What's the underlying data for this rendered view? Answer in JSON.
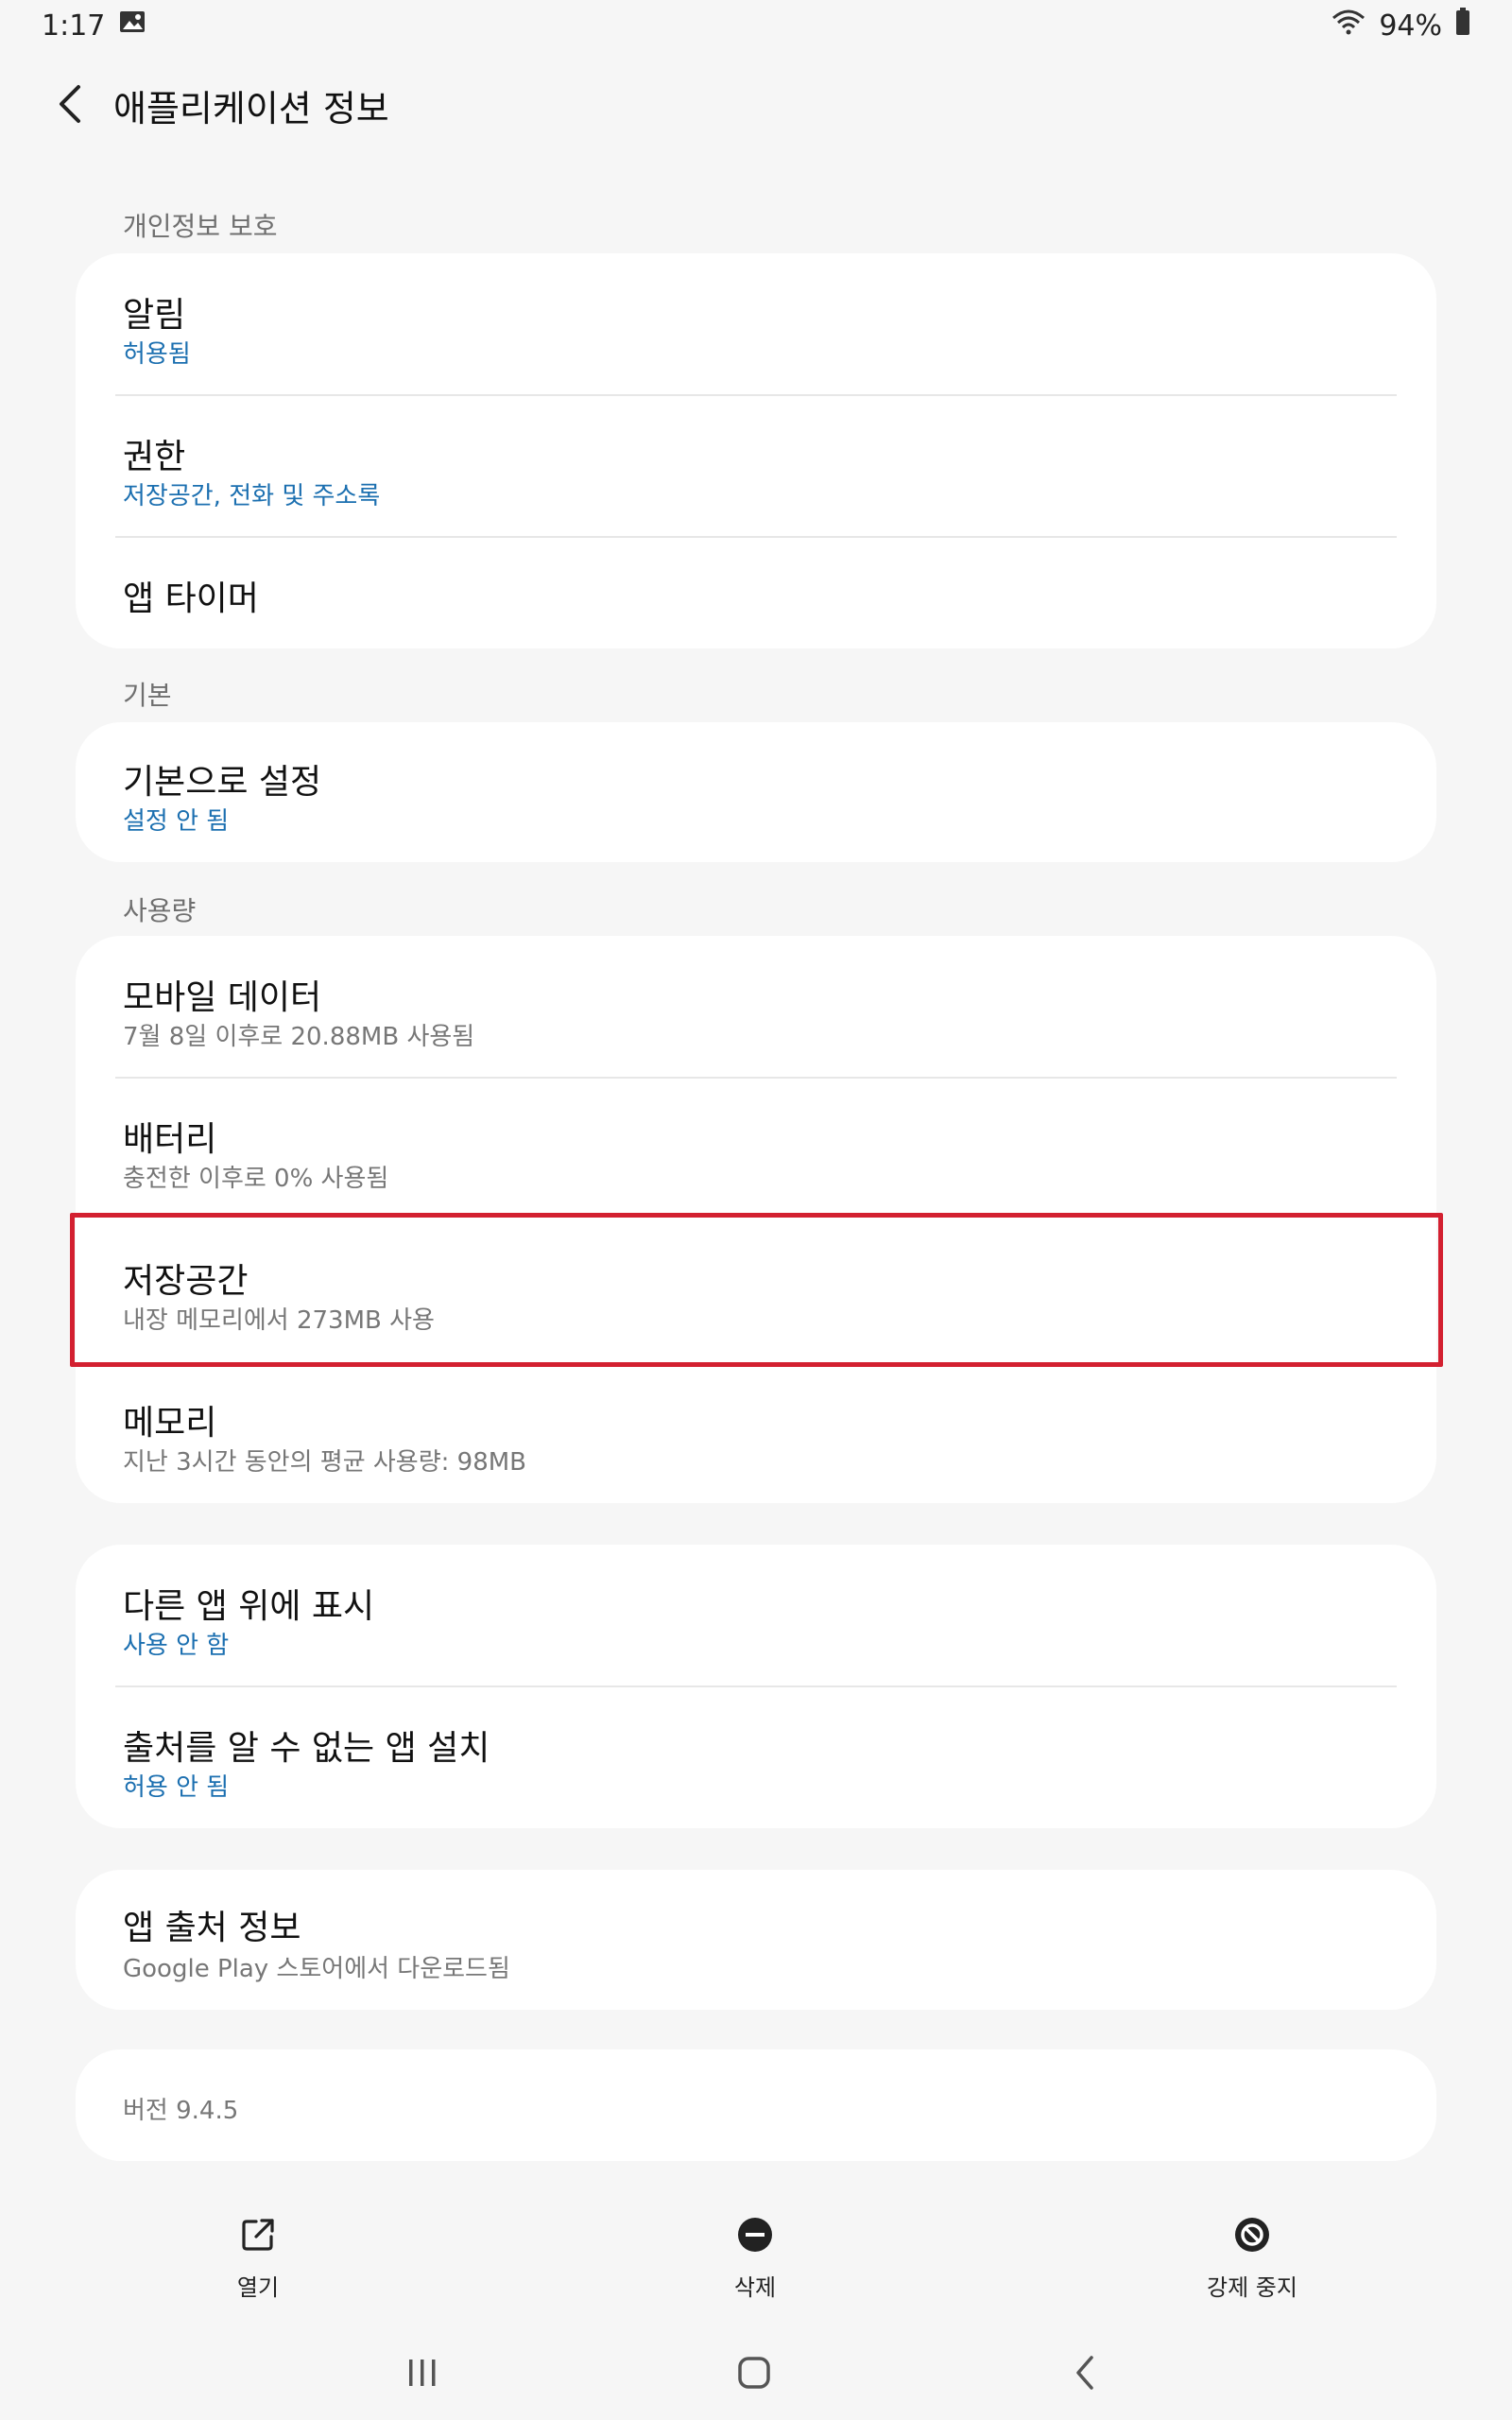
{
  "status": {
    "time": "1:17",
    "battery": "94%"
  },
  "header": {
    "title": "애플리케이션 정보"
  },
  "sections": {
    "privacy": "개인정보 보호",
    "basic": "기본",
    "usage": "사용량"
  },
  "privacy_items": [
    {
      "title": "알림",
      "subtitle": "허용됨"
    },
    {
      "title": "권한",
      "subtitle": "저장공간, 전화 및 주소록"
    },
    {
      "title": "앱 타이머"
    }
  ],
  "basic_items": [
    {
      "title": "기본으로 설정",
      "subtitle": "설정 안 됨"
    }
  ],
  "usage_items": [
    {
      "title": "모바일 데이터",
      "subtitle": "7월 8일 이후로 20.88MB 사용됨"
    },
    {
      "title": "배터리",
      "subtitle": "충전한 이후로 0% 사용됨"
    },
    {
      "title": "저장공간",
      "subtitle": "내장 메모리에서 273MB 사용"
    },
    {
      "title": "메모리",
      "subtitle": "지난 3시간 동안의 평균 사용량: 98MB"
    }
  ],
  "other_items": [
    {
      "title": "다른 앱 위에 표시",
      "subtitle": "사용 안 함"
    },
    {
      "title": "출처를 알 수 없는 앱 설치",
      "subtitle": "허용 안 됨"
    }
  ],
  "source_item": {
    "title": "앱 출처 정보",
    "subtitle": "Google Play 스토어에서 다운로드됨"
  },
  "version": "버전 9.4.5",
  "actions": {
    "open": "열기",
    "delete": "삭제",
    "force_stop": "강제 중지"
  },
  "colors": {
    "accent_blue": "#1b6fb0",
    "highlight_red": "#d32030"
  }
}
